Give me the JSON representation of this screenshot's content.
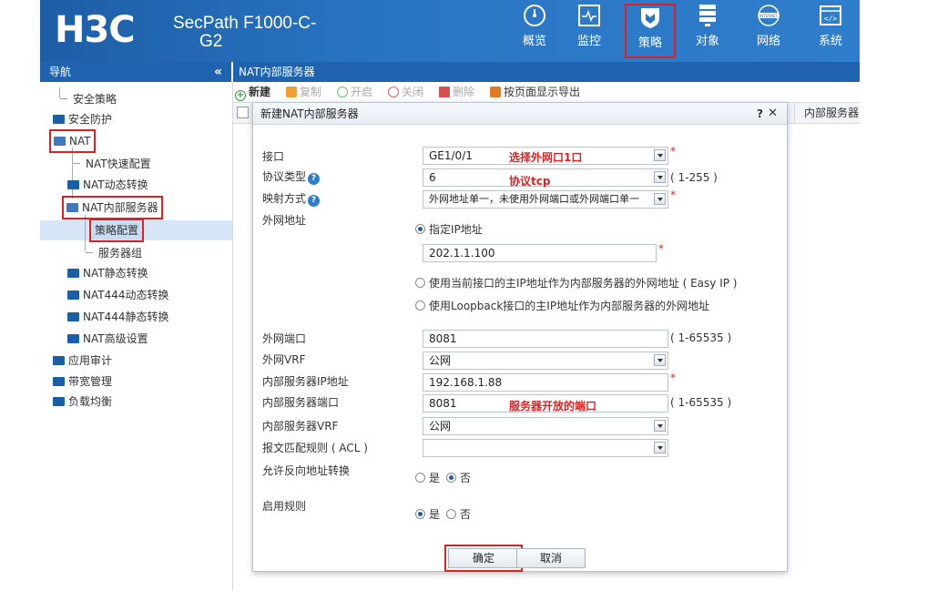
{
  "header": {
    "logo": "H3C",
    "product_line1": "SecPath F1000-C-",
    "product_line2": "G2",
    "nav": [
      {
        "label": "概览",
        "icon": "gauge-icon"
      },
      {
        "label": "监控",
        "icon": "monitor-icon"
      },
      {
        "label": "策略",
        "icon": "shield-icon",
        "active": true
      },
      {
        "label": "对象",
        "icon": "server-rack-icon"
      },
      {
        "label": "网络",
        "icon": "internet-icon"
      },
      {
        "label": "系统",
        "icon": "code-icon"
      }
    ]
  },
  "nav_bar": {
    "title": "导航",
    "collapse": "«"
  },
  "page_title": "NAT内部服务器",
  "sidebar": {
    "items": [
      {
        "label": "安全策略"
      },
      {
        "label": "安全防护"
      },
      {
        "label": "NAT"
      },
      {
        "label": "NAT快速配置"
      },
      {
        "label": "NAT动态转换"
      },
      {
        "label": "NAT内部服务器"
      },
      {
        "label": "策略配置"
      },
      {
        "label": "服务器组"
      },
      {
        "label": "NAT静态转换"
      },
      {
        "label": "NAT444动态转换"
      },
      {
        "label": "NAT444静态转换"
      },
      {
        "label": "NAT高级设置"
      },
      {
        "label": "应用审计"
      },
      {
        "label": "带宽管理"
      },
      {
        "label": "负载均衡"
      }
    ]
  },
  "toolbar": {
    "new": "新建",
    "copy": "复制",
    "enable": "开启",
    "disable": "关闭",
    "delete": "删除",
    "export": "按页面显示导出"
  },
  "table": {
    "col_internal": "内部服务器"
  },
  "dialog": {
    "title": "新建NAT内部服务器",
    "help": "?",
    "close": "✕",
    "fields": {
      "interface": {
        "label": "接口",
        "value": "GE1/0/1",
        "annotation": "选择外网口1口"
      },
      "protocol": {
        "label": "协议类型",
        "value": "6",
        "annotation": "协议tcp",
        "range": "( 1-255 )"
      },
      "mapping": {
        "label": "映射方式",
        "value": "外网地址单一，未使用外网端口或外网端口单一"
      },
      "public_addr": {
        "label": "外网地址",
        "opt_specified": "指定IP地址",
        "ip": "202.1.1.100",
        "opt_easy_ip": "使用当前接口的主IP地址作为内部服务器的外网地址 ( Easy IP )",
        "opt_loopback": "使用Loopback接口的主IP地址作为内部服务器的外网地址"
      },
      "public_port": {
        "label": "外网端口",
        "value": "8081",
        "range": "( 1-65535 )"
      },
      "public_vrf": {
        "label": "外网VRF",
        "value": "公网"
      },
      "internal_ip": {
        "label": "内部服务器IP地址",
        "value": "192.168.1.88"
      },
      "internal_port": {
        "label": "内部服务器端口",
        "value": "8081",
        "annotation": "服务器开放的端口",
        "range": "( 1-65535 )"
      },
      "internal_vrf": {
        "label": "内部服务器VRF",
        "value": "公网"
      },
      "acl": {
        "label": "报文匹配规则 ( ACL )",
        "value": ""
      },
      "reverse": {
        "label": "允许反向地址转换",
        "yes": "是",
        "no": "否"
      },
      "enable_rule": {
        "label": "启用规则",
        "yes": "是",
        "no": "否"
      }
    },
    "ok": "确定",
    "cancel": "取消"
  },
  "colors": {
    "header_blue": "#2a76c4",
    "bar_blue": "#1f63b0",
    "highlight_red": "#e02020"
  }
}
